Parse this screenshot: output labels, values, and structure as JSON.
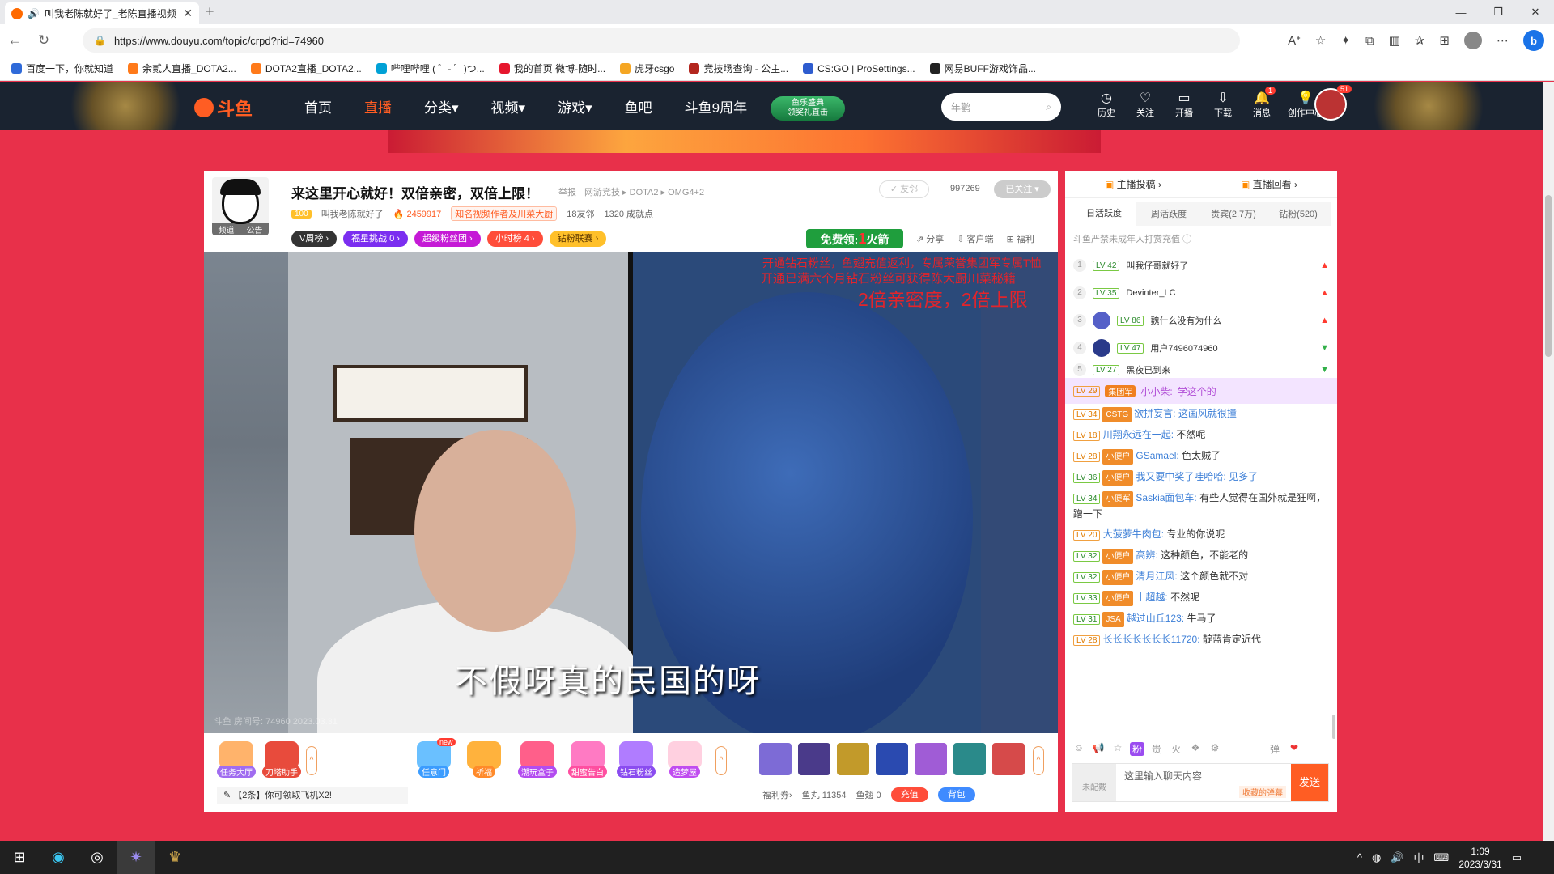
{
  "browser": {
    "tab_title": "叫我老陈就好了_老陈直播视频",
    "url": "https://www.douyu.com/topic/crpd?rid=74960",
    "bookmarks": [
      "百度一下，你就知道",
      "余贰人直播_DOTA2...",
      "DOTA2直播_DOTA2...",
      "哔哩哔哩 ( ゜- ゜)つ...",
      "我的首页 微博-随时...",
      "虎牙csgo",
      "竞技场查询 - 公主...",
      "CS:GO | ProSettings...",
      "网易BUFF游戏饰品..."
    ]
  },
  "site": {
    "logo": "斗鱼",
    "nav": [
      "首页",
      "直播",
      "分类▾",
      "视频▾",
      "游戏▾",
      "鱼吧",
      "斗鱼9周年"
    ],
    "promo": [
      "鱼乐盛典",
      "领奖礼直击"
    ],
    "search_placeholder": "年鹳",
    "header_icons": [
      {
        "label": "历史",
        "icon": "clock-icon"
      },
      {
        "label": "关注",
        "icon": "heart-icon"
      },
      {
        "label": "开播",
        "icon": "camera-icon"
      },
      {
        "label": "下载",
        "icon": "download-icon"
      },
      {
        "label": "消息",
        "icon": "bell-icon",
        "badge": "1"
      },
      {
        "label": "创作中心",
        "icon": "bulb-icon"
      }
    ],
    "user_badge": "51"
  },
  "room": {
    "title": "来这里开心就好！双倍亲密，双倍上限！",
    "report": "举报",
    "category": "网游竞技 ▸ DOTA2 ▸ OMG4+2",
    "avatar_bar": [
      "频道",
      "公告"
    ],
    "level_badge": "100",
    "anchor_name": "叫我老陈就好了",
    "heat": "2459917",
    "tagline": "知名视频作者及川菜大厨",
    "friends": "18友邻",
    "achievements": "1320 成就点",
    "friend_btn": "✓ 友邻",
    "fans": "997269",
    "followed": "已关注 ▾",
    "pills": [
      "V周榜 ›",
      "福星挑战 0 ›",
      "超级粉丝团 ›",
      "小时榜 4 ›",
      "钻粉联赛 ›"
    ],
    "free_fire": {
      "prefix": "免费领:",
      "num": "1",
      "suffix": "火箭"
    },
    "actions": [
      "⇗ 分享",
      "⇩ 客户端",
      "⊞ 福利"
    ]
  },
  "video": {
    "danmu": [
      "开通钻石粉丝，鱼翅充值返利，专属荣誉集团军专属T恤",
      "开通已满六个月钻石粉丝可获得陈大厨川菜秘籍",
      "2倍亲密度，2倍上限"
    ],
    "subtitle": "不假呀真的民国的呀",
    "watermark": "斗鱼 房间号: 74960 2023.03.31"
  },
  "gifts": {
    "left": [
      "任务大厅",
      "刀塔助手"
    ],
    "center": [
      "任意门",
      "祈福",
      "潮玩盒子",
      "甜蜜告白",
      "钻石粉丝",
      "造梦屋"
    ],
    "new_badge": "new",
    "tip": "【2条】你可领取飞机X2!",
    "wallet": {
      "welfare": "福利券›",
      "fishball": "鱼丸 11354",
      "fishfin": "鱼翅 0",
      "recharge": "充值",
      "bag": "背包"
    }
  },
  "chat": {
    "top": [
      "主播投稿 ›",
      "直播回看 ›"
    ],
    "rank_tabs": [
      "日活跃度",
      "周活跃度",
      "贵宾(2.7万)",
      "钻粉(520)"
    ],
    "warning": "斗鱼严禁未成年人打赏充值",
    "rank": [
      {
        "n": "1",
        "lv": "LV 42",
        "name": "叫我仔哥就好了",
        "trend": "up"
      },
      {
        "n": "2",
        "lv": "LV 35",
        "name": "Devinter_LC",
        "trend": "up"
      },
      {
        "n": "3",
        "lv": "LV 86",
        "name": "魏什么没有为什么",
        "trend": "up"
      },
      {
        "n": "4",
        "lv": "LV 47",
        "name": "用户7496074960",
        "trend": "down"
      },
      {
        "n": "5",
        "lv": "LV 27",
        "name": "黑夜已到来",
        "trend": "down"
      }
    ],
    "pinned": {
      "lv": "LV 29",
      "badge": "集团军",
      "user": "小小柴:",
      "text": "学这个的"
    },
    "messages": [
      {
        "lv": "LV 34",
        "badge": "CSTG",
        "user": "欲拼妄言:",
        "text": "这画风就很撞"
      },
      {
        "lv": "LV 18",
        "badge": "",
        "user": "川翔永远在一起:",
        "text": "不然呢"
      },
      {
        "lv": "LV 28",
        "badge": "小便户",
        "user": "GSamael:",
        "text": "色太贼了"
      },
      {
        "lv": "LV 36",
        "badge": "小便户",
        "user": "我又要中奖了哇哈哈:",
        "text": "见多了"
      },
      {
        "lv": "LV 34",
        "badge": "小便军",
        "user": "Saskia面包车:",
        "text": "有些人觉得在国外就是狂啊，蹭一下"
      },
      {
        "lv": "LV 20",
        "badge": "",
        "user": "大菠萝牛肉包:",
        "text": "专业的你说呢"
      },
      {
        "lv": "LV 32",
        "badge": "小便户",
        "user": "高辨:",
        "text": "这种颜色，不能老的"
      },
      {
        "lv": "LV 32",
        "badge": "小便户",
        "user": "清月江风:",
        "text": "这个颜色就不对"
      },
      {
        "lv": "LV 33",
        "badge": "小便户",
        "user": "丨超越:",
        "text": "不然呢"
      },
      {
        "lv": "LV 31",
        "badge": "JSA",
        "user": "越过山丘123:",
        "text": "牛马了"
      },
      {
        "lv": "LV 28",
        "badge": "",
        "user": "长长长长长长长11720:",
        "text": "靛蓝肯定近代"
      }
    ],
    "input_mask": "未配戴",
    "input_placeholder": "这里输入聊天内容",
    "collected": "收藏的弹幕",
    "send": "发送"
  },
  "taskbar": {
    "time": "1:09",
    "date": "2023/3/31",
    "ime": "中"
  }
}
